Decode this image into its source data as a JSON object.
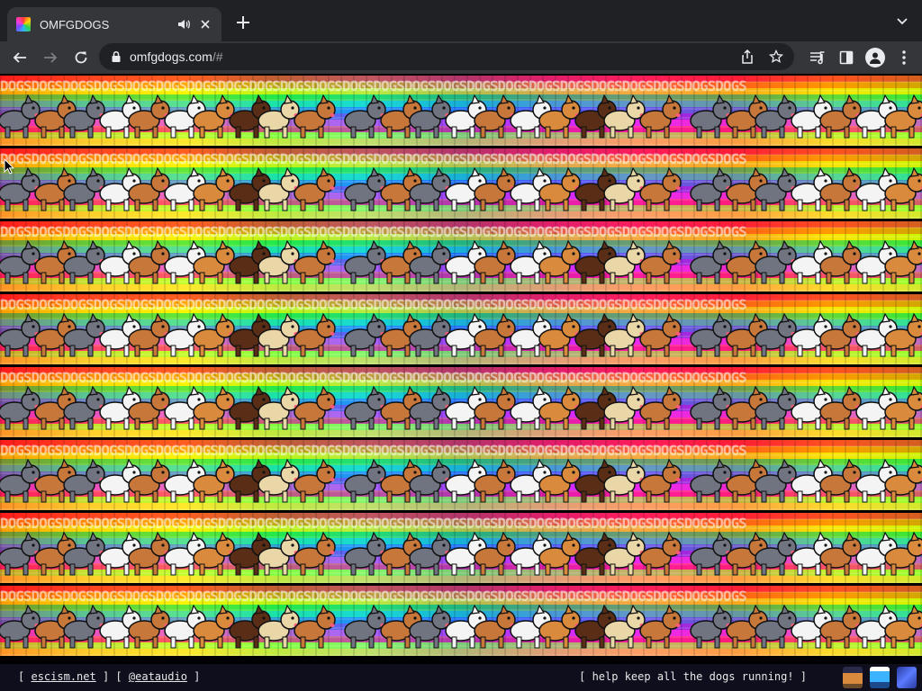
{
  "browser": {
    "tab_title": "OMFGDOGS",
    "url_domain": "omfgdogs.com",
    "url_path": "/#"
  },
  "page": {
    "band_count": 8,
    "band_text": "DOGSDOGSDOGSDOGSDOGSDOGSDOGSDOGSDOGSDOGSDOGSDOGSDOGSDOGSDOGSDOGSDOGSDOGSDOGSDOGSDOGSDOGSDOGSDOGS",
    "dog_colors": {
      "husky": "#6f7480",
      "shiba": "#c8773a",
      "white": "#f4f4f4",
      "dachshund": "#5a2e16",
      "pug": "#e9d7a8",
      "corgi": "#d98a3c"
    }
  },
  "footer": {
    "bracket_open": "[",
    "bracket_close": "]",
    "link1": "escism.net",
    "link2": "@eataudio",
    "right_text": "[ help keep all the dogs running! ]"
  },
  "icons": [
    "volume-icon",
    "close-icon",
    "plus-icon",
    "chevron-down-icon",
    "back-icon",
    "forward-icon",
    "reload-icon",
    "lock-icon",
    "share-icon",
    "star-icon",
    "media-icon",
    "sidepanel-icon",
    "profile-icon",
    "more-icon"
  ]
}
